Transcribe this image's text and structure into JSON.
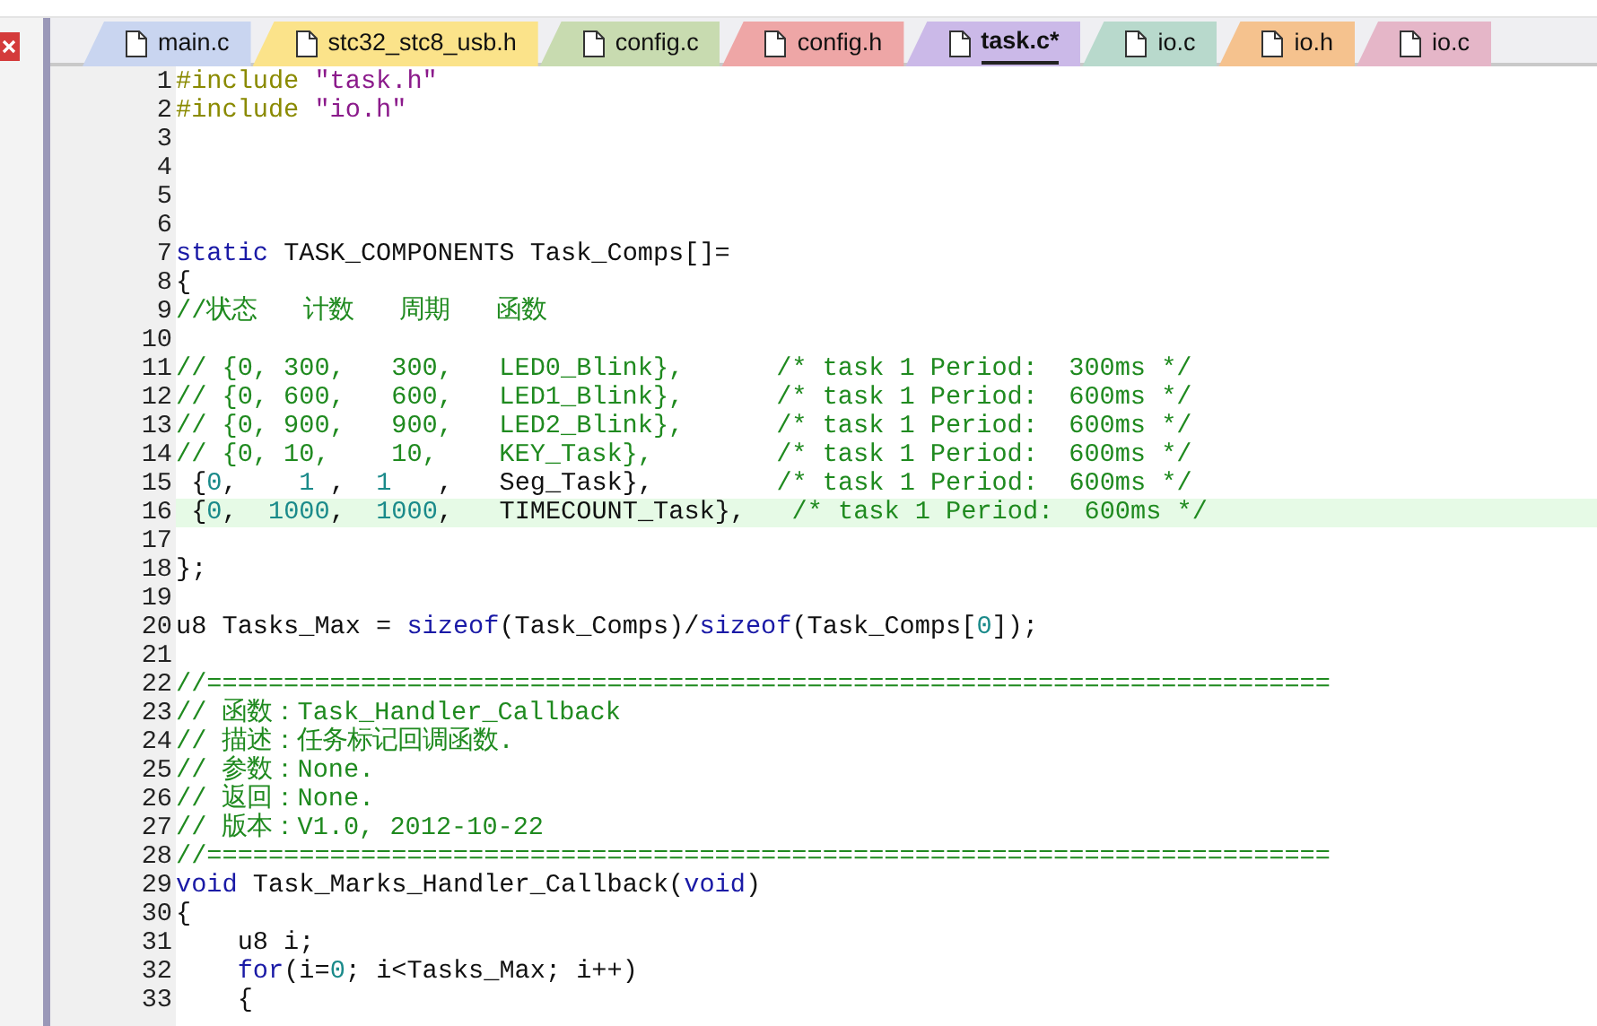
{
  "tabs": [
    {
      "label": "main.c",
      "color": "#c9d5f0",
      "selected": false
    },
    {
      "label": "stc32_stc8_usb.h",
      "color": "#fbe38a",
      "selected": false
    },
    {
      "label": "config.c",
      "color": "#c8dbb0",
      "selected": false
    },
    {
      "label": "config.h",
      "color": "#eea6a6",
      "selected": false
    },
    {
      "label": "task.c*",
      "color": "#cbb9e8",
      "selected": true
    },
    {
      "label": "io.c",
      "color": "#b8d9cc",
      "selected": false
    },
    {
      "label": "io.h",
      "color": "#f5c28e",
      "selected": false
    },
    {
      "label": "io.c",
      "color": "#e5b6c8",
      "selected": false
    }
  ],
  "lines": [
    {
      "number": "1",
      "current": false,
      "segments": [
        {
          "kind": "preproc",
          "text": "#include"
        },
        {
          "kind": "string",
          "text": " \"task.h\""
        }
      ]
    },
    {
      "number": "2",
      "current": false,
      "segments": [
        {
          "kind": "preproc",
          "text": "#include"
        },
        {
          "kind": "string",
          "text": " \"io.h\""
        }
      ]
    },
    {
      "number": "3",
      "current": false
    },
    {
      "number": "4",
      "current": false
    },
    {
      "number": "5",
      "current": false
    },
    {
      "number": "6",
      "current": false
    },
    {
      "number": "7",
      "current": false,
      "segments": [
        {
          "kind": "keyword",
          "text": "static"
        },
        {
          "kind": "plain",
          "text": " TASK_COMPONENTS Task_Comps[]="
        }
      ]
    },
    {
      "number": "8",
      "current": false,
      "segments": [
        {
          "kind": "plain",
          "text": "{"
        }
      ]
    },
    {
      "number": "9",
      "current": false,
      "segments": [
        {
          "kind": "comment",
          "text": "//状态   计数   周期   函数"
        }
      ]
    },
    {
      "number": "10",
      "current": false
    },
    {
      "number": "11",
      "current": false,
      "segments": [
        {
          "kind": "comment",
          "text": "// {0, 300,   300,   LED0_Blink},      /* task 1 Period:  300ms */"
        }
      ]
    },
    {
      "number": "12",
      "current": false,
      "segments": [
        {
          "kind": "comment",
          "text": "// {0, 600,   600,   LED1_Blink},      /* task 1 Period:  600ms */"
        }
      ]
    },
    {
      "number": "13",
      "current": false,
      "segments": [
        {
          "kind": "comment",
          "text": "// {0, 900,   900,   LED2_Blink},      /* task 1 Period:  600ms */"
        }
      ]
    },
    {
      "number": "14",
      "current": false,
      "segments": [
        {
          "kind": "comment",
          "text": "// {0, 10,    10,    KEY_Task},        /* task 1 Period:  600ms */"
        }
      ]
    },
    {
      "number": "15",
      "current": false,
      "segments": [
        {
          "kind": "plain",
          "text": " {"
        },
        {
          "kind": "number",
          "text": "0"
        },
        {
          "kind": "plain",
          "text": ",    "
        },
        {
          "kind": "number",
          "text": "1"
        },
        {
          "kind": "plain",
          "text": " ,  "
        },
        {
          "kind": "number",
          "text": "1"
        },
        {
          "kind": "plain",
          "text": "   ,   Seg_Task},        "
        },
        {
          "kind": "comment",
          "text": "/* task 1 Period:  600ms */"
        }
      ]
    },
    {
      "number": "16",
      "current": true,
      "segments": [
        {
          "kind": "plain",
          "text": " {"
        },
        {
          "kind": "number",
          "text": "0"
        },
        {
          "kind": "plain",
          "text": ",  "
        },
        {
          "kind": "number",
          "text": "1000"
        },
        {
          "kind": "plain",
          "text": ",  "
        },
        {
          "kind": "number",
          "text": "1000"
        },
        {
          "kind": "plain",
          "text": ",   TIMECOUNT_Task},   "
        },
        {
          "kind": "comment",
          "text": "/* task 1 Period:  600ms */"
        }
      ]
    },
    {
      "number": "17",
      "current": false
    },
    {
      "number": "18",
      "current": false,
      "segments": [
        {
          "kind": "plain",
          "text": "};"
        }
      ]
    },
    {
      "number": "19",
      "current": false
    },
    {
      "number": "20",
      "current": false,
      "segments": [
        {
          "kind": "plain",
          "text": "u8 Tasks_Max = "
        },
        {
          "kind": "keyword",
          "text": "sizeof"
        },
        {
          "kind": "plain",
          "text": "(Task_Comps)/"
        },
        {
          "kind": "keyword",
          "text": "sizeof"
        },
        {
          "kind": "plain",
          "text": "(Task_Comps["
        },
        {
          "kind": "number",
          "text": "0"
        },
        {
          "kind": "plain",
          "text": "]);"
        }
      ]
    },
    {
      "number": "21",
      "current": false
    },
    {
      "number": "22",
      "current": false,
      "segments": [
        {
          "kind": "comment",
          "text": "//========================================================================="
        }
      ]
    },
    {
      "number": "23",
      "current": false,
      "segments": [
        {
          "kind": "comment",
          "text": "// 函数：Task_Handler_Callback"
        }
      ]
    },
    {
      "number": "24",
      "current": false,
      "segments": [
        {
          "kind": "comment",
          "text": "// 描述：任务标记回调函数."
        }
      ]
    },
    {
      "number": "25",
      "current": false,
      "segments": [
        {
          "kind": "comment",
          "text": "// 参数：None."
        }
      ]
    },
    {
      "number": "26",
      "current": false,
      "segments": [
        {
          "kind": "comment",
          "text": "// 返回：None."
        }
      ]
    },
    {
      "number": "27",
      "current": false,
      "segments": [
        {
          "kind": "comment",
          "text": "// 版本：V1.0, 2012-10-22"
        }
      ]
    },
    {
      "number": "28",
      "current": false,
      "segments": [
        {
          "kind": "comment",
          "text": "//========================================================================="
        }
      ]
    },
    {
      "number": "29",
      "current": false,
      "segments": [
        {
          "kind": "keyword",
          "text": "void"
        },
        {
          "kind": "plain",
          "text": " Task_Marks_Handler_Callback("
        },
        {
          "kind": "keyword",
          "text": "void"
        },
        {
          "kind": "plain",
          "text": ")"
        }
      ]
    },
    {
      "number": "30",
      "current": false,
      "segments": [
        {
          "kind": "plain",
          "text": "{"
        }
      ]
    },
    {
      "number": "31",
      "current": false,
      "segments": [
        {
          "kind": "plain",
          "text": "    u8 i;"
        }
      ]
    },
    {
      "number": "32",
      "current": false,
      "segments": [
        {
          "kind": "keyword",
          "text": "    for"
        },
        {
          "kind": "plain",
          "text": "(i="
        },
        {
          "kind": "number",
          "text": "0"
        },
        {
          "kind": "plain",
          "text": "; i<Tasks_Max; i++)"
        }
      ]
    },
    {
      "number": "33",
      "current": false,
      "segments": [
        {
          "kind": "plain",
          "text": "    {"
        }
      ]
    }
  ]
}
